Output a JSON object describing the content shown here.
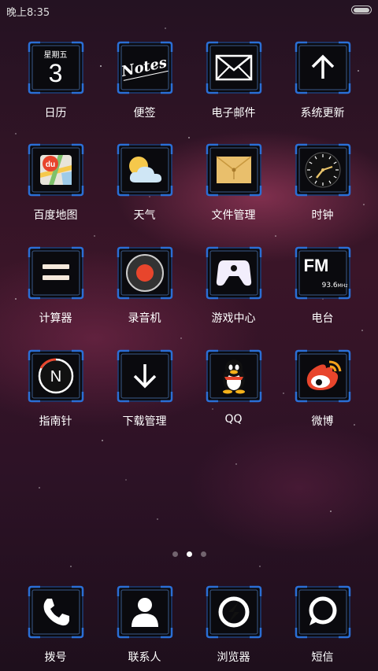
{
  "status_bar": {
    "time": "晚上8:35"
  },
  "calendar": {
    "weekday": "星期五",
    "day": "3"
  },
  "notes_icon_text": "Notes",
  "radio_icon": {
    "fm": "FM",
    "freq": "93.6",
    "unit": "MHz"
  },
  "du_icon_text": "du",
  "apps": [
    {
      "label": "日历",
      "icon": "calendar-icon"
    },
    {
      "label": "便签",
      "icon": "notes-icon"
    },
    {
      "label": "电子邮件",
      "icon": "mail-icon"
    },
    {
      "label": "系统更新",
      "icon": "arrow-up-icon"
    },
    {
      "label": "百度地图",
      "icon": "map-icon"
    },
    {
      "label": "天气",
      "icon": "weather-icon"
    },
    {
      "label": "文件管理",
      "icon": "folder-icon"
    },
    {
      "label": "时钟",
      "icon": "clock-icon"
    },
    {
      "label": "计算器",
      "icon": "equals-icon"
    },
    {
      "label": "录音机",
      "icon": "record-icon"
    },
    {
      "label": "游戏中心",
      "icon": "gamepad-icon"
    },
    {
      "label": "电台",
      "icon": "radio-icon"
    },
    {
      "label": "指南针",
      "icon": "compass-icon"
    },
    {
      "label": "下载管理",
      "icon": "download-icon"
    },
    {
      "label": "QQ",
      "icon": "qq-penguin-icon"
    },
    {
      "label": "微博",
      "icon": "weibo-icon"
    }
  ],
  "dock": [
    {
      "label": "拨号",
      "icon": "phone-icon"
    },
    {
      "label": "联系人",
      "icon": "contact-icon"
    },
    {
      "label": "浏览器",
      "icon": "browser-icon"
    },
    {
      "label": "短信",
      "icon": "message-icon"
    }
  ],
  "page_indicator": {
    "count": 3,
    "active": 1
  },
  "colors": {
    "frame_blue": "#2a6fd6",
    "accent_red": "#e8452c"
  }
}
